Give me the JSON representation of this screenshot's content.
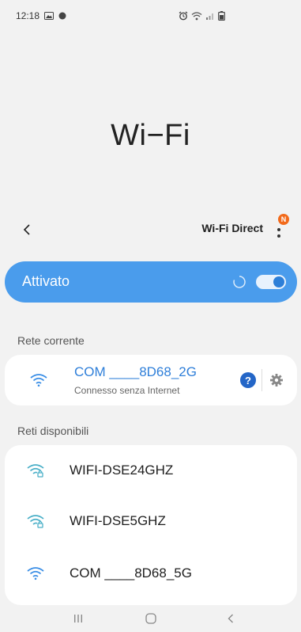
{
  "status_bar": {
    "time": "12:18"
  },
  "page": {
    "title": "Wi−Fi"
  },
  "actions": {
    "wifi_direct_label": "Wi-Fi Direct",
    "badge": "N"
  },
  "toggle_card": {
    "label": "Attivato",
    "enabled": true
  },
  "current_network": {
    "section_label": "Rete corrente",
    "name": "COM ____8D68_2G",
    "status": "Connesso senza Internet",
    "help_glyph": "?"
  },
  "available_networks": {
    "section_label": "Reti disponibili",
    "items": [
      {
        "name": "WIFI-DSE24GHZ",
        "icon": "wifi-lock-icon",
        "secured": true
      },
      {
        "name": "WIFI-DSE5GHZ",
        "icon": "wifi-lock-icon",
        "secured": true
      },
      {
        "name": "COM ____8D68_5G",
        "icon": "wifi-icon",
        "secured": false
      }
    ]
  },
  "colors": {
    "accent": "#4a9cec",
    "link_blue": "#2f7fd9",
    "wifi_icon_blue": "#3a8ee6",
    "wifi_icon_teal": "#4bb0c8",
    "badge_orange": "#f26a1b"
  }
}
